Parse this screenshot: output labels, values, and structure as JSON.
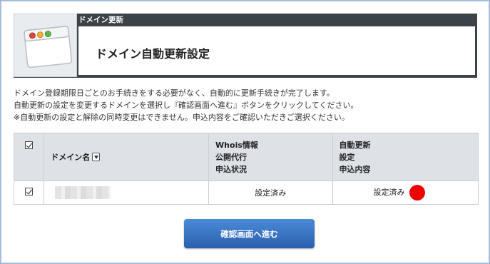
{
  "header": {
    "title_bar": "ドメイン更新",
    "heading": "ドメイン自動更新設定",
    "icon": "browser-window-icon"
  },
  "description": {
    "lines": [
      "ドメイン登録期限日ごとのお手続きをする必要がなく、自動的に更新手続きが完了します。",
      "自動更新の設定を変更するドメインを選択し『確認画面へ進む』ボタンをクリックしてください。",
      "※自動更新の設定と解除の同時変更はできません。申込内容をご確認いただきご選択ください。"
    ]
  },
  "table": {
    "headers": {
      "select_all_checked": true,
      "domain": "ドメイン名",
      "whois_lines": [
        "Whois情報",
        "公開代行",
        "申込状況"
      ],
      "auto_lines": [
        "自動更新",
        "設定",
        "申込内容"
      ]
    },
    "rows": [
      {
        "checked": true,
        "domain": "",
        "whois_status": "設定済み",
        "auto_status": "設定済み",
        "status_color": "#ee0000"
      }
    ]
  },
  "buttons": {
    "confirm": "確認画面へ進む"
  },
  "colors": {
    "header_bar": "#3b4248",
    "button": "#3a74c4",
    "table_header_bg": "#dee2e7"
  }
}
